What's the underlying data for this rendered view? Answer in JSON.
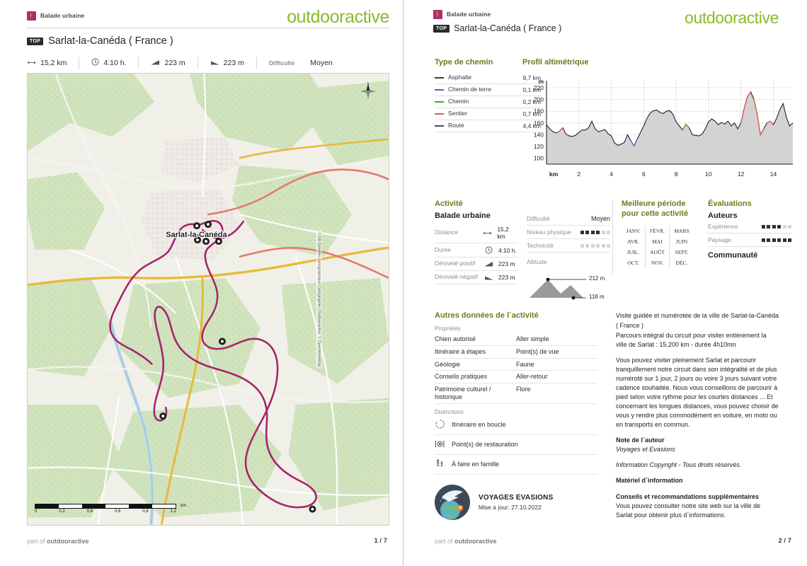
{
  "brand": "outdooractive",
  "category": {
    "label": "Balade urbaine",
    "badge_color": "#b32a6e",
    "icon": "hiker-icon"
  },
  "top_badge": "TOP",
  "title": "Sarlat-la-Canéda ( France )",
  "stats": [
    {
      "icon": "distance-icon",
      "value": "15,2 km"
    },
    {
      "icon": "clock-icon",
      "value": "4:10 h."
    },
    {
      "icon": "ascent-icon",
      "value": "223 m"
    },
    {
      "icon": "descent-icon",
      "value": "223 m"
    },
    {
      "label": "Difficulté",
      "value": "Moyen"
    }
  ],
  "map": {
    "center_label": "Sarlat-la-Canéda",
    "attribution": "© GB Données cartographique Cartographie | Outdooractive, © OpenStreetMap",
    "scale_unit": "km",
    "scale_ticks": [
      "0",
      "0,2",
      "0,4",
      "0,6",
      "0,8",
      "1,2"
    ],
    "route_color": "#a6246f",
    "compass": "N"
  },
  "footer": {
    "part_of_prefix": "part of",
    "part_of_brand": "outdooractive",
    "page_left": "1 / 7",
    "page_right": "2 / 7"
  },
  "path_type": {
    "heading": "Type de chemin",
    "rows": [
      {
        "name": "Asphalte",
        "value": "9,7 km",
        "color": "#3c3c3c"
      },
      {
        "name": "Chemin de terre",
        "value": "0,1 km",
        "color": "#3b6fb5"
      },
      {
        "name": "Chemin",
        "value": "0,2 km",
        "color": "#4aa832"
      },
      {
        "name": "Sentier",
        "value": "0,7 km",
        "color": "#e0574e"
      },
      {
        "name": "Route",
        "value": "4,4 km",
        "color": "#4a4a4a"
      }
    ]
  },
  "chart_data": {
    "type": "area",
    "title": "Profil altimétrique",
    "xlabel": "km",
    "ylabel": "m",
    "xlim": [
      0,
      15.2
    ],
    "ylim": [
      90,
      232
    ],
    "grid": true,
    "y_ticks": [
      100,
      120,
      140,
      160,
      180,
      200,
      220
    ],
    "x_ticks": [
      2,
      4,
      6,
      8,
      10,
      12,
      14
    ],
    "x": [
      0,
      0.2,
      0.4,
      0.6,
      0.8,
      1,
      1.2,
      1.4,
      1.6,
      1.8,
      2,
      2.2,
      2.4,
      2.6,
      2.8,
      3,
      3.2,
      3.4,
      3.6,
      3.8,
      4,
      4.2,
      4.4,
      4.6,
      4.8,
      5,
      5.2,
      5.4,
      5.6,
      5.8,
      6,
      6.2,
      6.4,
      6.6,
      6.8,
      7,
      7.2,
      7.4,
      7.6,
      7.8,
      8,
      8.2,
      8.4,
      8.6,
      8.8,
      9,
      9.2,
      9.4,
      9.6,
      9.8,
      10,
      10.2,
      10.4,
      10.6,
      10.8,
      11,
      11.2,
      11.4,
      11.6,
      11.8,
      12,
      12.2,
      12.4,
      12.6,
      12.8,
      13,
      13.2,
      13.4,
      13.6,
      13.8,
      14,
      14.2,
      14.4,
      14.6,
      14.8,
      15,
      15.2
    ],
    "values": [
      157,
      150,
      145,
      143,
      146,
      152,
      141,
      138,
      137,
      139,
      144,
      148,
      148,
      152,
      163,
      150,
      145,
      147,
      149,
      142,
      138,
      126,
      122,
      124,
      127,
      140,
      130,
      121,
      133,
      144,
      155,
      168,
      177,
      181,
      182,
      178,
      176,
      180,
      181,
      175,
      162,
      155,
      148,
      158,
      152,
      140,
      139,
      138,
      141,
      150,
      162,
      167,
      163,
      157,
      161,
      158,
      163,
      155,
      160,
      150,
      160,
      185,
      205,
      213,
      200,
      175,
      140,
      150,
      160,
      163,
      157,
      168,
      183,
      193,
      170,
      155,
      160
    ],
    "series_segments": [
      {
        "name": "Asphalte",
        "color": "#3c3c3c"
      },
      {
        "name": "Sentier",
        "color": "#e0574e"
      },
      {
        "name": "Chemin",
        "color": "#4aa832"
      },
      {
        "name": "Chemin de terre",
        "color": "#3b6fb5"
      }
    ],
    "area_fill": "#d3d3d3",
    "line_color": "#222222"
  },
  "activity": {
    "heading": "Activité",
    "name": "Balade urbaine",
    "rows": [
      {
        "label": "Distance",
        "icon": "distance-icon",
        "value": "15,2 km"
      },
      {
        "label": "Durée",
        "icon": "clock-icon",
        "value": "4:10 h."
      },
      {
        "label": "Dénivelé positif",
        "icon": "ascent-icon",
        "value": "223 m"
      },
      {
        "label": "Dénivelé négatif",
        "icon": "descent-icon",
        "value": "223 m"
      }
    ],
    "difficulty_label": "Difficulté",
    "difficulty_value": "Moyen",
    "ratings": [
      {
        "label": "Niveau physique",
        "filled": 4,
        "total": 6
      },
      {
        "label": "Technicité",
        "filled": 0,
        "total": 6
      }
    ],
    "altitude_label": "Altitude",
    "altitude_max": "212 m",
    "altitude_min": "118 m"
  },
  "best_period": {
    "heading_line1": "Meilleure période",
    "heading_line2": "pour cette activité",
    "months": [
      "JANV.",
      "FÉVR.",
      "MARS",
      "AVR.",
      "MAI",
      "JUIN",
      "JUIL.",
      "AOÛT",
      "SEPT.",
      "OCT.",
      "NOV.",
      "DÉC."
    ]
  },
  "evaluations": {
    "heading": "Évaluations",
    "authors_heading": "Auteurs",
    "rows": [
      {
        "label": "Expérience",
        "filled": 4,
        "total": 6
      },
      {
        "label": "Paysage",
        "filled": 6,
        "total": 6
      }
    ],
    "community_heading": "Communauté"
  },
  "other_data": {
    "heading": "Autres données de l`activité",
    "properties_label": "Propriétés",
    "properties": [
      "Chien autorisé",
      "Aller simple",
      "Itinéraire à étapes",
      "Point(s) de vue",
      "Géologie",
      "Faune",
      "Conseils pratiques",
      "Aller-retour",
      "Patrimoine culturel / historique",
      "Flore"
    ],
    "distinctions_label": "Distinctions",
    "distinctions": [
      {
        "icon": "loop-icon",
        "label": "Itinéraire en boucle"
      },
      {
        "icon": "restaurant-icon",
        "label": "Point(s) de restauration"
      },
      {
        "icon": "family-icon",
        "label": "À faire en famille"
      }
    ]
  },
  "author": {
    "logo_icon": "globe-plane-icon",
    "name": "VOYAGES EVASIONS",
    "updated": "Mise à jour: 27.10.2022"
  },
  "description": {
    "intro_bold": "Visite guidée et numérotée de la ville de Sarlat-la-Canéda ( France )",
    "intro_2": "Parcours intégral du circuit pour visiter entièrement la ville de Sarlat : 15,200 km - durée 4h10mn",
    "body": "Vous pouvez visiter pleinement Sarlat et parcourir tranquillement notre circuit dans son intégralité et de plus numéroté sur 1 jour, 2 jours ou voire 3 jours suivant votre cadence souhaitée. Nous vous conseillons de parcourir à pied selon votre rythme pour les courtes distances ... Et concernant les longues distances, vous pouvez choisir de vous y rendre plus commodément en voiture, en moto ou en transports en commun.",
    "note_title": "Note de l`auteur",
    "note_value": "Voyages et Evasions",
    "copyright": "Information Copyright - Tous droits réservés.",
    "material_heading": "Matériel d`information",
    "material_title": "Conseils et recommandations supplémentaires",
    "material_body": "Vous pouvez consulter notre site web sur la ville de Sarlat pour obtenir plus d`informations."
  }
}
